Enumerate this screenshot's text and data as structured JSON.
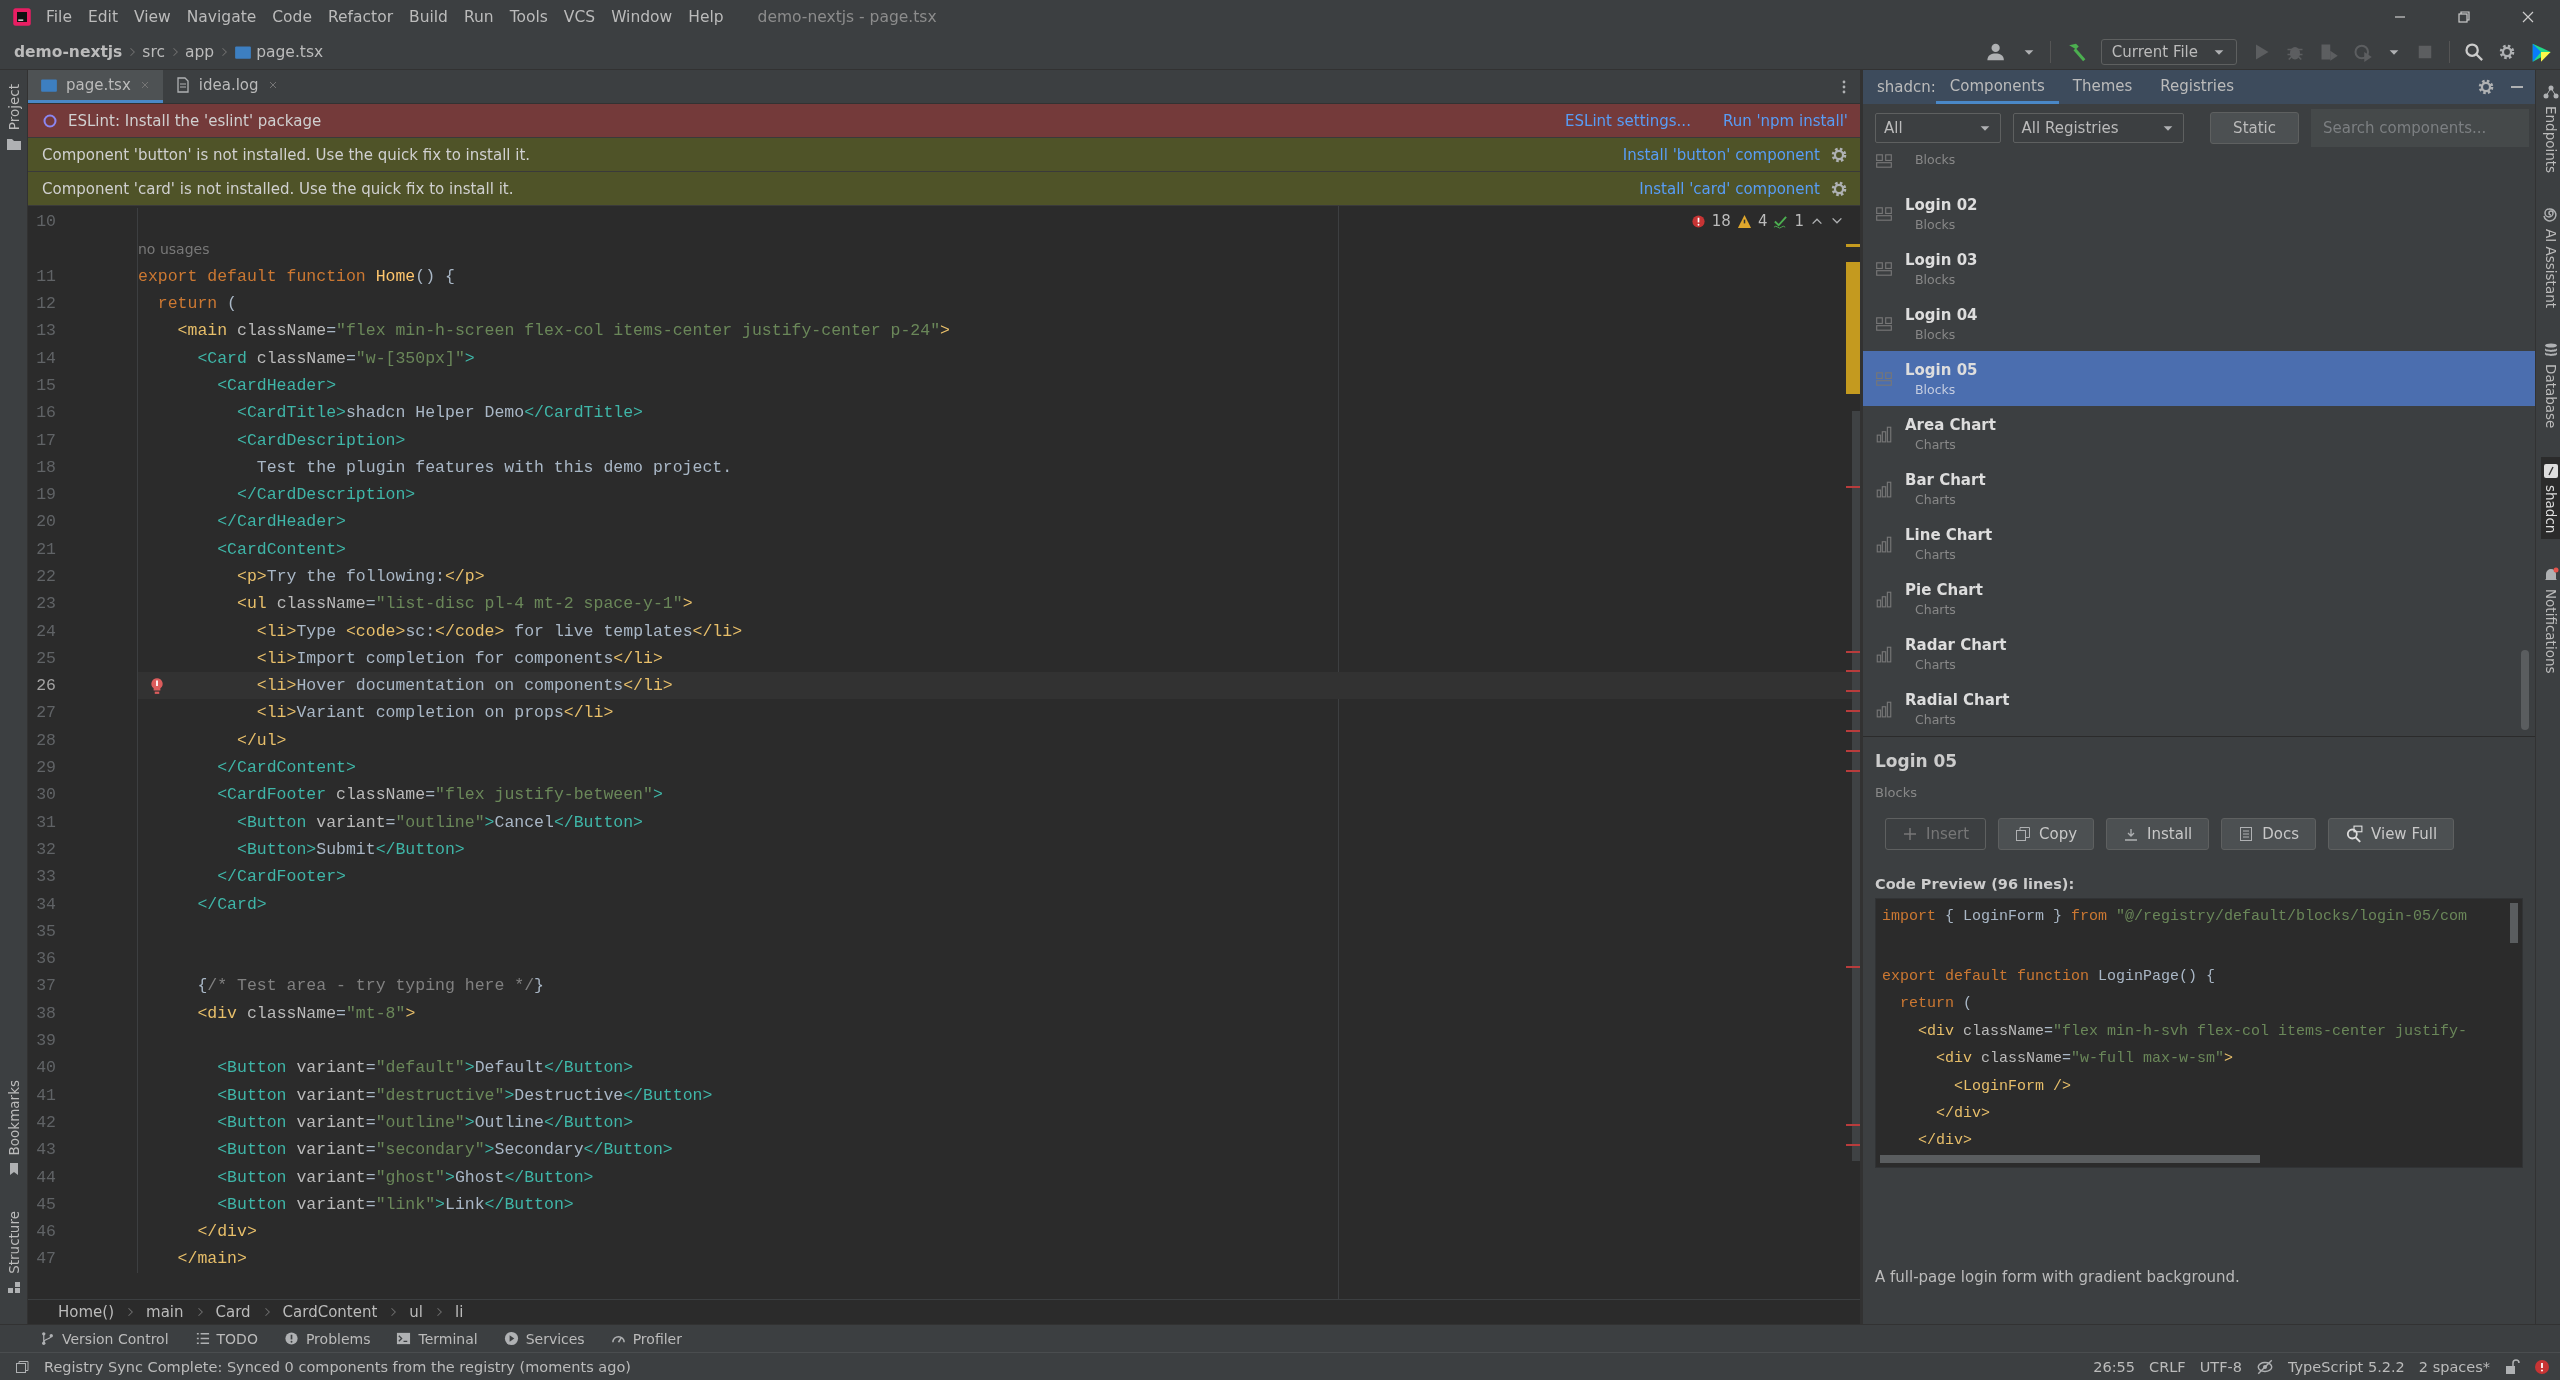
{
  "menu_bar": {
    "items": [
      "File",
      "Edit",
      "View",
      "Navigate",
      "Code",
      "Refactor",
      "Build",
      "Run",
      "Tools",
      "VCS",
      "Window",
      "Help"
    ],
    "title": "demo-nextjs - page.tsx"
  },
  "nav_bar": {
    "path": [
      "demo-nextjs",
      "src",
      "app",
      "page.tsx"
    ],
    "run_config": "Current File"
  },
  "left_stripe": {
    "top": [
      {
        "label": "Project",
        "kind": "folder"
      }
    ],
    "bottom": [
      {
        "label": "Bookmarks",
        "kind": "bookmark"
      },
      {
        "label": "Structure",
        "kind": "blocks"
      }
    ]
  },
  "editor_tabs": [
    {
      "label": "page.tsx",
      "kind": "tsx",
      "selected": true
    },
    {
      "label": "idea.log",
      "kind": "log",
      "selected": false
    }
  ],
  "banners": [
    {
      "kind": "error",
      "text": "ESLint: Install the 'eslint' package",
      "actions": [
        "ESLint settings...",
        "Run 'npm install'"
      ]
    },
    {
      "kind": "warning",
      "text": "Component 'button' is not installed. Use the quick fix to install it.",
      "actions": [
        "Install 'button' component"
      ]
    },
    {
      "kind": "warning",
      "text": "Component 'card' is not installed. Use the quick fix to install it.",
      "actions": [
        "Install 'card' component"
      ]
    }
  ],
  "inspections": {
    "errors": "18",
    "warnings": "4",
    "typos": "1"
  },
  "editor": {
    "lines": [
      {
        "kind": "code",
        "number": "10",
        "current": false,
        "error_mark": false
      },
      {
        "kind": "inlay",
        "text": "no usages"
      },
      {
        "kind": "code",
        "number": "11",
        "current": false,
        "error_mark": false,
        "tokens": [
          {
            "kind": "keyword",
            "text": "export default function "
          },
          {
            "kind": "function",
            "text": "Home"
          },
          {
            "kind": "text",
            "text": "() {"
          }
        ]
      },
      {
        "kind": "code",
        "number": "12",
        "current": false,
        "error_mark": false,
        "tokens": [
          {
            "kind": "keyword",
            "text": "  return"
          },
          {
            "kind": "text",
            "text": " ("
          }
        ]
      },
      {
        "kind": "code",
        "number": "13",
        "current": false,
        "error_mark": false,
        "tokens": [
          {
            "kind": "tag",
            "text": "    <main"
          },
          {
            "kind": "attribute",
            "text": " className"
          },
          {
            "kind": "operator",
            "text": "="
          },
          {
            "kind": "string",
            "text": "\"flex min-h-screen flex-col items-center justify-center p-24\""
          },
          {
            "kind": "tag",
            "text": ">"
          }
        ]
      },
      {
        "kind": "code",
        "number": "14",
        "current": false,
        "error_mark": false,
        "tokens": [
          {
            "kind": "component",
            "text": "      <Card"
          },
          {
            "kind": "attribute",
            "text": " className"
          },
          {
            "kind": "operator",
            "text": "="
          },
          {
            "kind": "string",
            "text": "\"w-[350px]\""
          },
          {
            "kind": "component",
            "text": ">"
          }
        ]
      },
      {
        "kind": "code",
        "number": "15",
        "current": false,
        "error_mark": false,
        "tokens": [
          {
            "kind": "component",
            "text": "        <CardHeader>"
          }
        ]
      },
      {
        "kind": "code",
        "number": "16",
        "current": false,
        "error_mark": false,
        "tokens": [
          {
            "kind": "component",
            "text": "          <CardTitle>"
          },
          {
            "kind": "text",
            "text": "shadcn Helper Demo"
          },
          {
            "kind": "component",
            "text": "</CardTitle>"
          }
        ]
      },
      {
        "kind": "code",
        "number": "17",
        "current": false,
        "error_mark": false,
        "tokens": [
          {
            "kind": "component",
            "text": "          <CardDescription>"
          }
        ]
      },
      {
        "kind": "code",
        "number": "18",
        "current": false,
        "error_mark": false,
        "tokens": [
          {
            "kind": "text",
            "text": "            Test the plugin features with this demo project."
          }
        ]
      },
      {
        "kind": "code",
        "number": "19",
        "current": false,
        "error_mark": false,
        "tokens": [
          {
            "kind": "component",
            "text": "          </CardDescription>"
          }
        ]
      },
      {
        "kind": "code",
        "number": "20",
        "current": false,
        "error_mark": false,
        "tokens": [
          {
            "kind": "component",
            "text": "        </CardHeader>"
          }
        ]
      },
      {
        "kind": "code",
        "number": "21",
        "current": false,
        "error_mark": false,
        "tokens": [
          {
            "kind": "component",
            "text": "        <CardContent>"
          }
        ]
      },
      {
        "kind": "code",
        "number": "22",
        "current": false,
        "error_mark": false,
        "tokens": [
          {
            "kind": "tag",
            "text": "          <p>"
          },
          {
            "kind": "text",
            "text": "Try the following:"
          },
          {
            "kind": "tag",
            "text": "</p>"
          }
        ]
      },
      {
        "kind": "code",
        "number": "23",
        "current": false,
        "error_mark": false,
        "tokens": [
          {
            "kind": "tag",
            "text": "          <ul"
          },
          {
            "kind": "attribute",
            "text": " className"
          },
          {
            "kind": "operator",
            "text": "="
          },
          {
            "kind": "string",
            "text": "\"list-disc pl-4 mt-2 space-y-1\""
          },
          {
            "kind": "tag",
            "text": ">"
          }
        ]
      },
      {
        "kind": "code",
        "number": "24",
        "current": false,
        "error_mark": false,
        "tokens": [
          {
            "kind": "tag",
            "text": "            <li>"
          },
          {
            "kind": "text",
            "text": "Type "
          },
          {
            "kind": "tag",
            "text": "<code>"
          },
          {
            "kind": "text",
            "text": "sc:"
          },
          {
            "kind": "tag",
            "text": "</code>"
          },
          {
            "kind": "text",
            "text": " for live templates"
          },
          {
            "kind": "tag",
            "text": "</li>"
          }
        ]
      },
      {
        "kind": "code",
        "number": "25",
        "current": false,
        "error_mark": false,
        "tokens": [
          {
            "kind": "tag",
            "text": "            <li>"
          },
          {
            "kind": "text",
            "text": "Import completion for components"
          },
          {
            "kind": "tag",
            "text": "</li>"
          }
        ]
      },
      {
        "kind": "code",
        "number": "26",
        "current": true,
        "error_mark": true,
        "tokens": [
          {
            "kind": "tag",
            "text": "            <li>"
          },
          {
            "kind": "text",
            "text": "Hover documentation on components"
          },
          {
            "kind": "tag",
            "text": "</li>"
          }
        ]
      },
      {
        "kind": "code",
        "number": "27",
        "current": false,
        "error_mark": false,
        "tokens": [
          {
            "kind": "tag",
            "text": "            <li>"
          },
          {
            "kind": "text",
            "text": "Variant completion on props"
          },
          {
            "kind": "tag",
            "text": "</li>"
          }
        ]
      },
      {
        "kind": "code",
        "number": "28",
        "current": false,
        "error_mark": false,
        "tokens": [
          {
            "kind": "tag",
            "text": "          </ul>"
          }
        ]
      },
      {
        "kind": "code",
        "number": "29",
        "current": false,
        "error_mark": false,
        "tokens": [
          {
            "kind": "component",
            "text": "        </CardContent>"
          }
        ]
      },
      {
        "kind": "code",
        "number": "30",
        "current": false,
        "error_mark": false,
        "tokens": [
          {
            "kind": "component",
            "text": "        <CardFooter"
          },
          {
            "kind": "attribute",
            "text": " className"
          },
          {
            "kind": "operator",
            "text": "="
          },
          {
            "kind": "string",
            "text": "\"flex justify-between\""
          },
          {
            "kind": "component",
            "text": ">"
          }
        ]
      },
      {
        "kind": "code",
        "number": "31",
        "current": false,
        "error_mark": false,
        "tokens": [
          {
            "kind": "component",
            "text": "          <Button"
          },
          {
            "kind": "attribute",
            "text": " variant"
          },
          {
            "kind": "operator",
            "text": "="
          },
          {
            "kind": "string",
            "text": "\"outline\""
          },
          {
            "kind": "component",
            "text": ">"
          },
          {
            "kind": "text",
            "text": "Cancel"
          },
          {
            "kind": "component",
            "text": "</Button>"
          }
        ]
      },
      {
        "kind": "code",
        "number": "32",
        "current": false,
        "error_mark": false,
        "tokens": [
          {
            "kind": "component",
            "text": "          <Button>"
          },
          {
            "kind": "text",
            "text": "Submit"
          },
          {
            "kind": "component",
            "text": "</Button>"
          }
        ]
      },
      {
        "kind": "code",
        "number": "33",
        "current": false,
        "error_mark": false,
        "tokens": [
          {
            "kind": "component",
            "text": "        </CardFooter>"
          }
        ]
      },
      {
        "kind": "code",
        "number": "34",
        "current": false,
        "error_mark": false,
        "tokens": [
          {
            "kind": "component",
            "text": "      </Card>"
          }
        ]
      },
      {
        "kind": "code",
        "number": "35",
        "current": false,
        "error_mark": false
      },
      {
        "kind": "code",
        "number": "36",
        "current": false,
        "error_mark": false
      },
      {
        "kind": "code",
        "number": "37",
        "current": false,
        "error_mark": false,
        "tokens": [
          {
            "kind": "text",
            "text": "      {"
          },
          {
            "kind": "comment",
            "text": "/* Test area - try typing here */"
          },
          {
            "kind": "text",
            "text": "}"
          }
        ]
      },
      {
        "kind": "code",
        "number": "38",
        "current": false,
        "error_mark": false,
        "tokens": [
          {
            "kind": "tag",
            "text": "      <div"
          },
          {
            "kind": "attribute",
            "text": " className"
          },
          {
            "kind": "operator",
            "text": "="
          },
          {
            "kind": "string",
            "text": "\"mt-8\""
          },
          {
            "kind": "tag",
            "text": ">"
          }
        ]
      },
      {
        "kind": "code",
        "number": "39",
        "current": false,
        "error_mark": false
      },
      {
        "kind": "code",
        "number": "40",
        "current": false,
        "error_mark": false,
        "tokens": [
          {
            "kind": "component",
            "text": "        <Button"
          },
          {
            "kind": "attribute",
            "text": " variant"
          },
          {
            "kind": "operator",
            "text": "="
          },
          {
            "kind": "string",
            "text": "\"default\""
          },
          {
            "kind": "component",
            "text": ">"
          },
          {
            "kind": "text",
            "text": "Default"
          },
          {
            "kind": "component",
            "text": "</Button>"
          }
        ]
      },
      {
        "kind": "code",
        "number": "41",
        "current": false,
        "error_mark": false,
        "tokens": [
          {
            "kind": "component",
            "text": "        <Button"
          },
          {
            "kind": "attribute",
            "text": " variant"
          },
          {
            "kind": "operator",
            "text": "="
          },
          {
            "kind": "string",
            "text": "\"destructive\""
          },
          {
            "kind": "component",
            "text": ">"
          },
          {
            "kind": "text",
            "text": "Destructive"
          },
          {
            "kind": "component",
            "text": "</Button>"
          }
        ]
      },
      {
        "kind": "code",
        "number": "42",
        "current": false,
        "error_mark": false,
        "tokens": [
          {
            "kind": "component",
            "text": "        <Button"
          },
          {
            "kind": "attribute",
            "text": " variant"
          },
          {
            "kind": "operator",
            "text": "="
          },
          {
            "kind": "string",
            "text": "\"outline\""
          },
          {
            "kind": "component",
            "text": ">"
          },
          {
            "kind": "text",
            "text": "Outline"
          },
          {
            "kind": "component",
            "text": "</Button>"
          }
        ]
      },
      {
        "kind": "code",
        "number": "43",
        "current": false,
        "error_mark": false,
        "tokens": [
          {
            "kind": "component",
            "text": "        <Button"
          },
          {
            "kind": "attribute",
            "text": " variant"
          },
          {
            "kind": "operator",
            "text": "="
          },
          {
            "kind": "string",
            "text": "\"secondary\""
          },
          {
            "kind": "component",
            "text": ">"
          },
          {
            "kind": "text",
            "text": "Secondary"
          },
          {
            "kind": "component",
            "text": "</Button>"
          }
        ]
      },
      {
        "kind": "code",
        "number": "44",
        "current": false,
        "error_mark": false,
        "tokens": [
          {
            "kind": "component",
            "text": "        <Button"
          },
          {
            "kind": "attribute",
            "text": " variant"
          },
          {
            "kind": "operator",
            "text": "="
          },
          {
            "kind": "string",
            "text": "\"ghost\""
          },
          {
            "kind": "component",
            "text": ">"
          },
          {
            "kind": "text",
            "text": "Ghost"
          },
          {
            "kind": "component",
            "text": "</Button>"
          }
        ]
      },
      {
        "kind": "code",
        "number": "45",
        "current": false,
        "error_mark": false,
        "tokens": [
          {
            "kind": "component",
            "text": "        <Button"
          },
          {
            "kind": "attribute",
            "text": " variant"
          },
          {
            "kind": "operator",
            "text": "="
          },
          {
            "kind": "string",
            "text": "\"link\""
          },
          {
            "kind": "component",
            "text": ">"
          },
          {
            "kind": "text",
            "text": "Link"
          },
          {
            "kind": "component",
            "text": "</Button>"
          }
        ]
      },
      {
        "kind": "code",
        "number": "46",
        "current": false,
        "error_mark": false,
        "tokens": [
          {
            "kind": "tag",
            "text": "      </div>"
          }
        ]
      },
      {
        "kind": "code",
        "number": "47",
        "current": false,
        "error_mark": false,
        "tokens": [
          {
            "kind": "tag",
            "text": "    </main>"
          }
        ]
      }
    ]
  },
  "breadcrumbs": [
    "Home()",
    "main",
    "Card",
    "CardContent",
    "ul",
    "li"
  ],
  "tool_windows": [
    {
      "label": "Version Control",
      "kind": "branch"
    },
    {
      "label": "TODO",
      "kind": "list"
    },
    {
      "label": "Problems",
      "kind": "alert"
    },
    {
      "label": "Terminal",
      "kind": "terminal"
    },
    {
      "label": "Services",
      "kind": "play"
    },
    {
      "label": "Profiler",
      "kind": "gauge"
    }
  ],
  "status_bar": {
    "message": "Registry Sync Complete: Synced 0 components from the registry (moments ago)",
    "items": [
      "26:55",
      "CRLF",
      "UTF-8",
      "TypeScript 5.2.2",
      "2 spaces*"
    ]
  },
  "panel": {
    "label": "shadcn:",
    "tabs": [
      {
        "label": "Components",
        "selected": true
      },
      {
        "label": "Themes",
        "selected": false
      },
      {
        "label": "Registries",
        "selected": false
      }
    ],
    "filters": {
      "type": "All",
      "registry": "All Registries",
      "mode_button": "Static",
      "placeholder": "Search components..."
    },
    "items": [
      {
        "kind": "block",
        "category": "Blocks",
        "selected": false
      },
      {
        "kind": "block",
        "title": "Login 02",
        "category": "Blocks",
        "selected": false
      },
      {
        "kind": "block",
        "title": "Login 03",
        "category": "Blocks",
        "selected": false
      },
      {
        "kind": "block",
        "title": "Login 04",
        "category": "Blocks",
        "selected": false
      },
      {
        "kind": "block",
        "title": "Login 05",
        "category": "Blocks",
        "selected": true
      },
      {
        "kind": "chart",
        "title": "Area Chart",
        "category": "Charts",
        "selected": false
      },
      {
        "kind": "chart",
        "title": "Bar Chart",
        "category": "Charts",
        "selected": false
      },
      {
        "kind": "chart",
        "title": "Line Chart",
        "category": "Charts",
        "selected": false
      },
      {
        "kind": "chart",
        "title": "Pie Chart",
        "category": "Charts",
        "selected": false
      },
      {
        "kind": "chart",
        "title": "Radar Chart",
        "category": "Charts",
        "selected": false
      },
      {
        "kind": "chart",
        "title": "Radial Chart",
        "category": "Charts",
        "selected": false
      }
    ],
    "details": {
      "title": "Login 05",
      "category": "Blocks",
      "actions": [
        {
          "label": "Insert",
          "kind": "insert",
          "disabled": true
        },
        {
          "label": "Copy",
          "kind": "copy",
          "disabled": false
        },
        {
          "label": "Install",
          "kind": "install",
          "disabled": false
        },
        {
          "label": "Docs",
          "kind": "docs",
          "disabled": false
        },
        {
          "label": "View Full",
          "kind": "view",
          "disabled": false
        }
      ],
      "preview_label": "Code Preview (96 lines):",
      "preview_lines": [
        {
          "blank_line_before": false,
          "tokens": [
            {
              "kind": "keyword",
              "text": "import"
            },
            {
              "kind": "text",
              "text": " { LoginForm } "
            },
            {
              "kind": "keyword",
              "text": "from"
            },
            {
              "kind": "string",
              "text": " \"@/registry/default/blocks/login-05/com"
            }
          ]
        },
        {
          "blank_line_before": true,
          "tokens": [
            {
              "kind": "keyword",
              "text": "export default function"
            },
            {
              "kind": "text",
              "text": " LoginPage() {"
            }
          ]
        },
        {
          "blank_line_before": false,
          "tokens": [
            {
              "kind": "keyword",
              "text": "  return"
            },
            {
              "kind": "text",
              "text": " ("
            }
          ]
        },
        {
          "blank_line_before": false,
          "tokens": [
            {
              "kind": "tag",
              "text": "    <div"
            },
            {
              "kind": "attribute",
              "text": " className"
            },
            {
              "kind": "operator",
              "text": "="
            },
            {
              "kind": "string",
              "text": "\"flex min-h-svh flex-col items-center justify-"
            }
          ]
        },
        {
          "blank_line_before": false,
          "tokens": [
            {
              "kind": "tag",
              "text": "      <div"
            },
            {
              "kind": "attribute",
              "text": " className"
            },
            {
              "kind": "operator",
              "text": "="
            },
            {
              "kind": "string",
              "text": "\"w-full max-w-sm\""
            },
            {
              "kind": "tag",
              "text": ">"
            }
          ]
        },
        {
          "blank_line_before": false,
          "tokens": [
            {
              "kind": "tag",
              "text": "        <LoginForm />"
            }
          ]
        },
        {
          "blank_line_before": false,
          "tokens": [
            {
              "kind": "tag",
              "text": "      </div>"
            }
          ]
        },
        {
          "blank_line_before": false,
          "tokens": [
            {
              "kind": "tag",
              "text": "    </div>"
            }
          ]
        }
      ],
      "description": "A full-page login form with gradient background."
    }
  },
  "right_stripe": [
    {
      "label": "Endpoints",
      "kind": "nodes",
      "selected": false
    },
    {
      "label": "AI Assistant",
      "kind": "spiral",
      "selected": false
    },
    {
      "label": "Database",
      "kind": "database",
      "selected": false
    },
    {
      "label": "shadcn",
      "kind": "slash",
      "selected": true
    },
    {
      "label": "Notifications",
      "kind": "bell",
      "selected": false
    }
  ]
}
